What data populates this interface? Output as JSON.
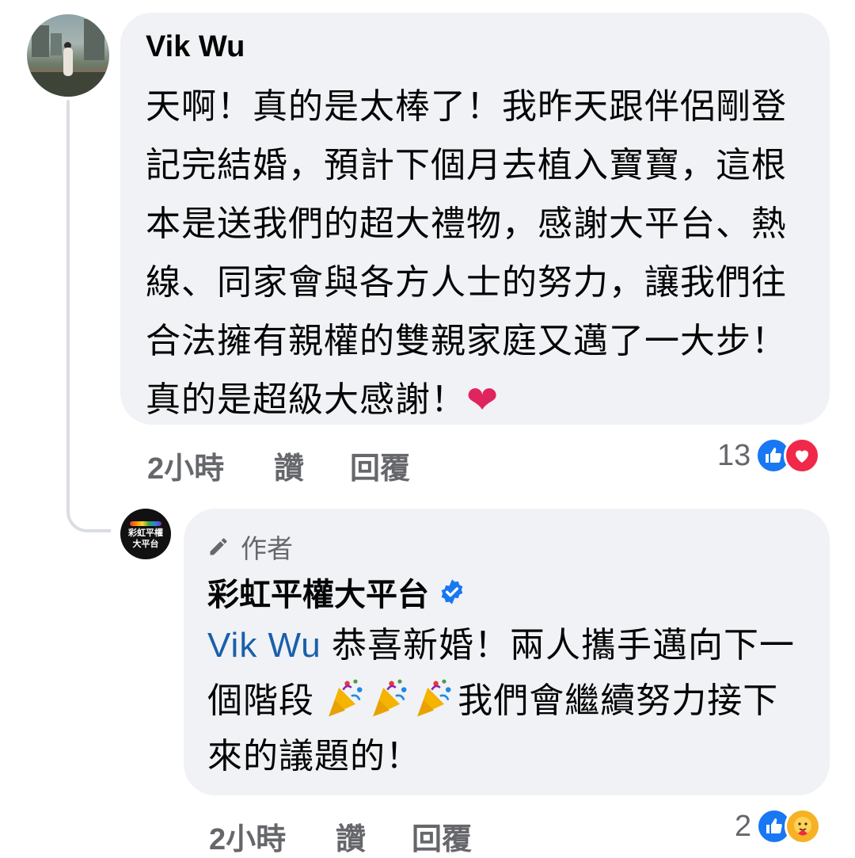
{
  "comment": {
    "author": "Vik Wu",
    "text": "天啊！真的是太棒了！我昨天跟伴侶剛登記完結婚，預計下個月去植入寶寶，這根本是送我們的超大禮物，感謝大平台、熱線、同家會與各方人士的努力，讓我們往合法擁有親權的雙親家庭又邁了一大步！真的是超級大感謝！",
    "emoji": "❤",
    "time": "2小時",
    "like_label": "讚",
    "reply_label": "回覆",
    "reaction_count": "13",
    "reaction_icons": [
      "like-icon",
      "love-icon"
    ]
  },
  "reply": {
    "author_badge": "作者",
    "author": "彩虹平權大平台",
    "verified": true,
    "logo_text_line1": "彩虹平權",
    "logo_text_line2": "大平台",
    "mention": "Vik Wu",
    "text_part1": " 恭喜新婚！兩人攜手邁向下一個階段 ",
    "text_part2": "我們會繼續努力接下來的議題的！",
    "emojis": [
      "party-popper-icon",
      "party-popper-icon",
      "party-popper-icon"
    ],
    "time": "2小時",
    "like_label": "讚",
    "reply_label": "回覆",
    "reaction_count": "2",
    "reaction_icons": [
      "like-icon",
      "care-icon"
    ]
  },
  "colors": {
    "bubble": "#f0f2f5",
    "meta_text": "#65676b",
    "mention": "#1b5faa",
    "like": "#1877f2",
    "love": "#f02849",
    "care": "#f7b125"
  }
}
